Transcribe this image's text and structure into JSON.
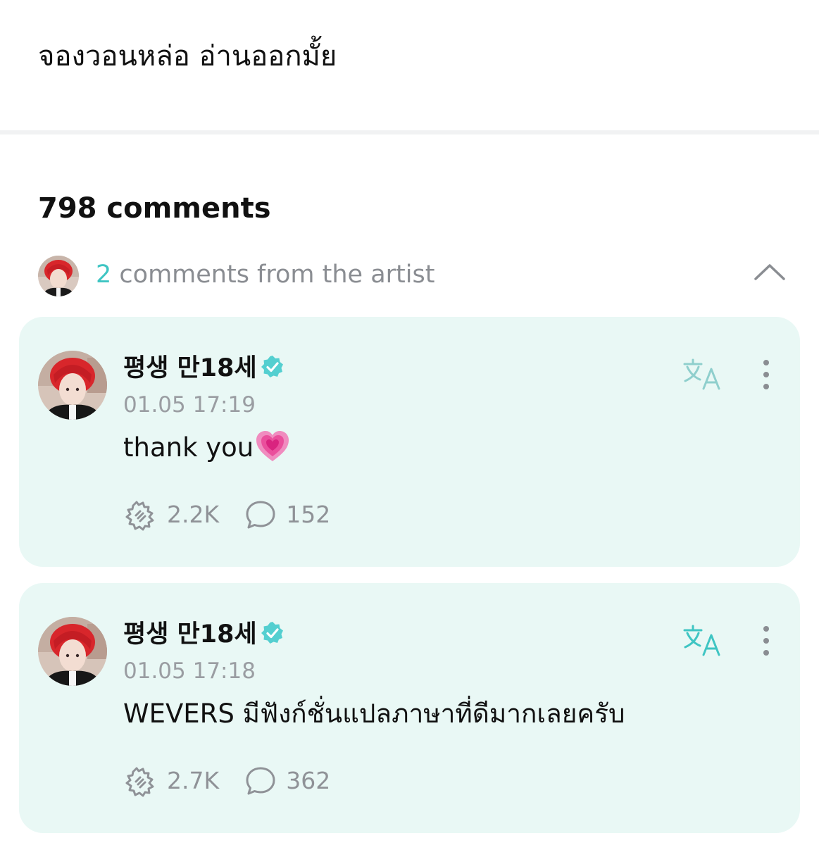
{
  "post": {
    "text": "จองวอนหล่อ อ่านออกมั้ย"
  },
  "comments_header": {
    "count_label": "798 comments"
  },
  "artist_summary": {
    "count": "2",
    "label": " comments from the artist"
  },
  "artist_comments": [
    {
      "author": "평생 만18세",
      "timestamp": "01.05 17:19",
      "text": "thank you",
      "likes": "2.2K",
      "replies": "152"
    },
    {
      "author": "평생 만18세",
      "timestamp": "01.05 17:18",
      "text": "WEVERS มีฟังก์ชั่นแปลภาษาที่ดีมากเลยครับ",
      "likes": "2.7K",
      "replies": "362"
    }
  ],
  "colors": {
    "accent": "#3fc5c3",
    "card_background": "#e9f8f5",
    "muted_text": "#8a8d92",
    "heart": "#f06aa8"
  },
  "icons": {
    "verified": "verified-badge-icon",
    "translate": "translate-icon",
    "more": "more-vertical-icon",
    "like": "cheer-hand-icon",
    "reply": "speech-bubble-icon",
    "collapse": "chevron-up-icon",
    "heart": "growing-heart-emoji"
  }
}
